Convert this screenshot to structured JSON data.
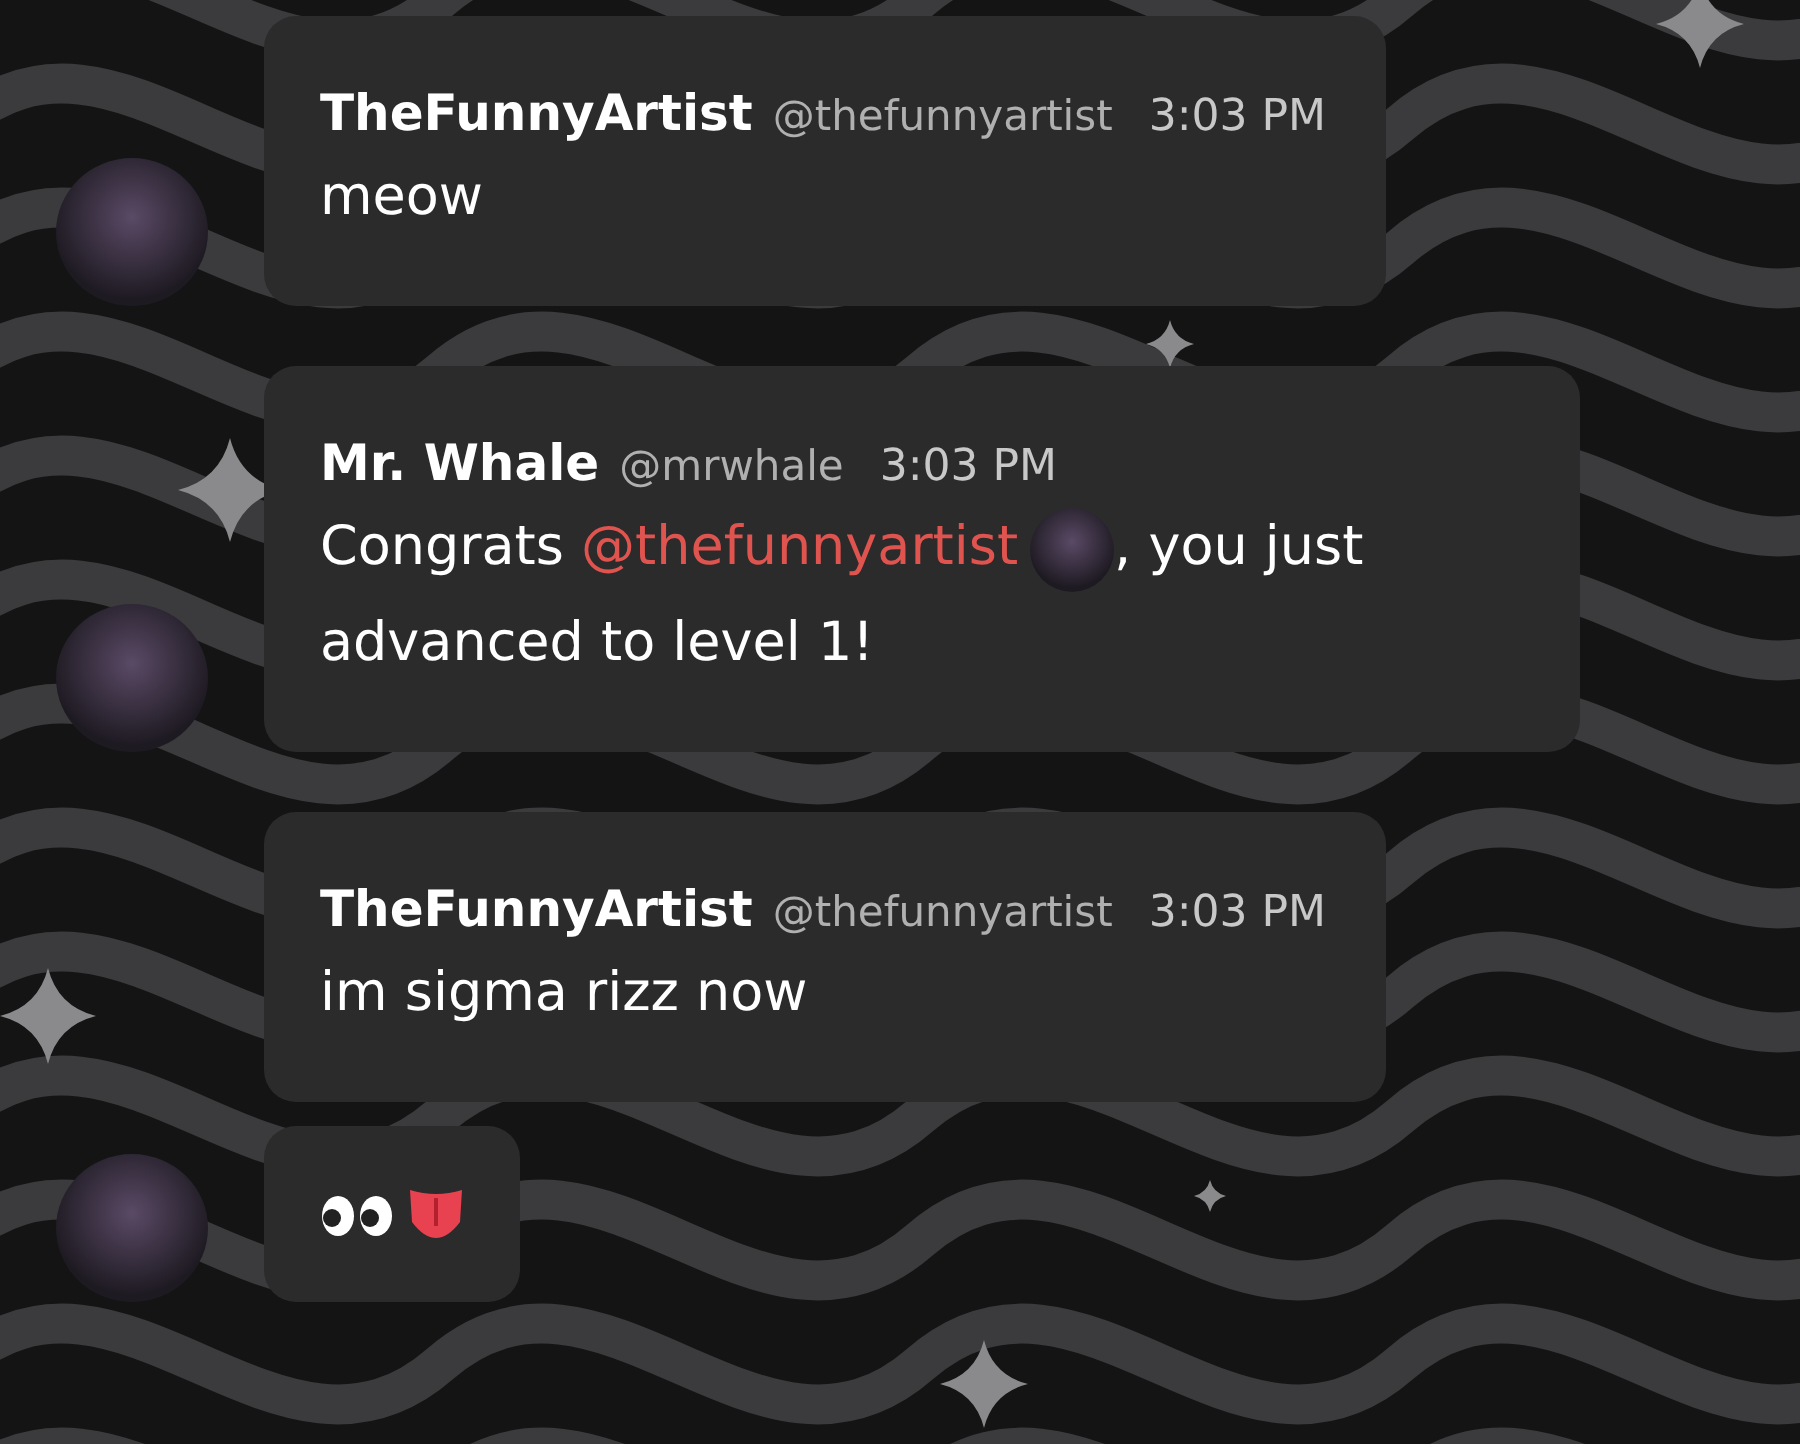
{
  "messages": [
    {
      "author": "TheFunnyArtist",
      "handle": "@thefunnyartist",
      "time": "3:03 PM",
      "show_avatar": true,
      "body": [
        {
          "kind": "text",
          "text": "meow"
        }
      ]
    },
    {
      "author": "Mr. Whale",
      "handle": "@mrwhale",
      "time": "3:03 PM",
      "show_avatar": true,
      "body": [
        {
          "kind": "text",
          "text": "Congrats "
        },
        {
          "kind": "mention",
          "text": "@thefunnyartist"
        },
        {
          "kind": "avatar"
        },
        {
          "kind": "text",
          "text": ", you just advanced to level 1!"
        }
      ]
    },
    {
      "author": "TheFunnyArtist",
      "handle": "@thefunnyartist",
      "time": "3:03 PM",
      "show_avatar": false,
      "body": [
        {
          "kind": "text",
          "text": "im sigma rizz now"
        }
      ]
    },
    {
      "show_avatar": true,
      "body": [
        {
          "kind": "eyes"
        },
        {
          "kind": "tongue"
        }
      ]
    }
  ]
}
